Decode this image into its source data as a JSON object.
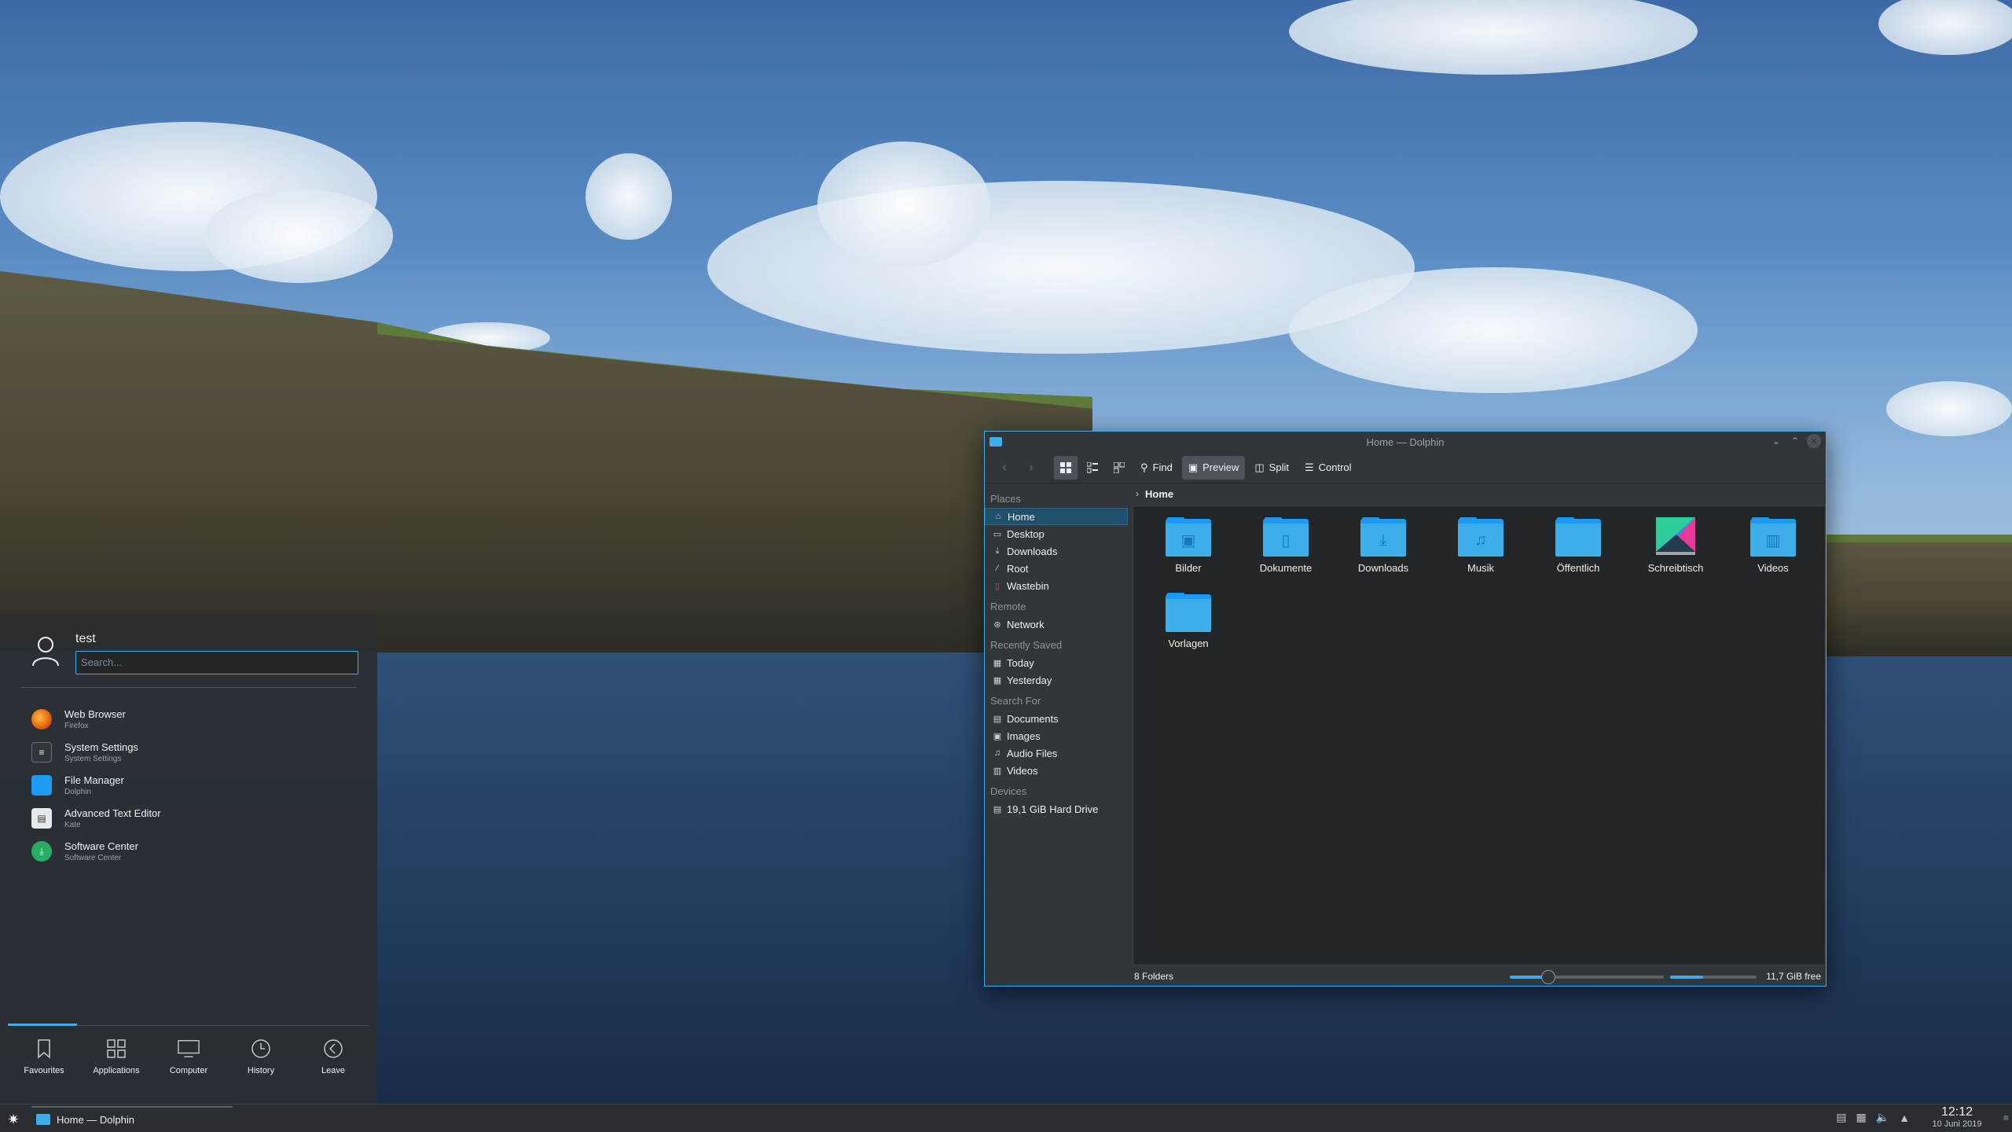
{
  "window": {
    "title": "Home — Dolphin"
  },
  "toolbar": {
    "find_label": "Find",
    "preview_label": "Preview",
    "split_label": "Split",
    "control_label": "Control"
  },
  "places": {
    "sections": [
      {
        "header": "Places",
        "items": [
          {
            "label": "Home",
            "icon": "home-icon",
            "selected": true
          },
          {
            "label": "Desktop",
            "icon": "desktop-icon"
          },
          {
            "label": "Downloads",
            "icon": "download-icon"
          },
          {
            "label": "Root",
            "icon": "root-icon"
          },
          {
            "label": "Wastebin",
            "icon": "trash-icon"
          }
        ]
      },
      {
        "header": "Remote",
        "items": [
          {
            "label": "Network",
            "icon": "network-icon"
          }
        ]
      },
      {
        "header": "Recently Saved",
        "items": [
          {
            "label": "Today",
            "icon": "calendar-icon"
          },
          {
            "label": "Yesterday",
            "icon": "calendar-icon"
          }
        ]
      },
      {
        "header": "Search For",
        "items": [
          {
            "label": "Documents",
            "icon": "document-icon"
          },
          {
            "label": "Images",
            "icon": "image-icon"
          },
          {
            "label": "Audio Files",
            "icon": "music-icon"
          },
          {
            "label": "Videos",
            "icon": "video-icon"
          }
        ]
      },
      {
        "header": "Devices",
        "items": [
          {
            "label": "19,1 GiB Hard Drive",
            "icon": "harddrive-icon"
          }
        ]
      }
    ]
  },
  "breadcrumb": {
    "current": "Home"
  },
  "files": [
    {
      "label": "Bilder",
      "icon": "image-icon"
    },
    {
      "label": "Dokumente",
      "icon": "document-icon"
    },
    {
      "label": "Downloads",
      "icon": "download-icon"
    },
    {
      "label": "Musik",
      "icon": "music-icon"
    },
    {
      "label": "Öffentlich",
      "icon": "public-icon"
    },
    {
      "label": "Schreibtisch",
      "icon": "desktop-folder-icon"
    },
    {
      "label": "Videos",
      "icon": "video-icon"
    },
    {
      "label": "Vorlagen",
      "icon": "template-icon"
    }
  ],
  "statusbar": {
    "folder_count": "8 Folders",
    "free_space": "11,7 GiB free",
    "zoom_level": 0.25,
    "disk_used_fraction": 0.38
  },
  "launcher": {
    "user_name": "test",
    "search_placeholder": "Search...",
    "favourites": [
      {
        "name": "Web Browser",
        "desc": "Firefox",
        "icon": "firefox-icon"
      },
      {
        "name": "System Settings",
        "desc": "System Settings",
        "icon": "settings-icon"
      },
      {
        "name": "File Manager",
        "desc": "Dolphin",
        "icon": "dolphin-icon"
      },
      {
        "name": "Advanced Text Editor",
        "desc": "Kate",
        "icon": "kate-icon"
      },
      {
        "name": "Software Center",
        "desc": "Software Center",
        "icon": "discover-icon"
      }
    ],
    "tabs": [
      {
        "label": "Favourites",
        "icon": "bookmark-icon"
      },
      {
        "label": "Applications",
        "icon": "apps-grid-icon"
      },
      {
        "label": "Computer",
        "icon": "monitor-icon"
      },
      {
        "label": "History",
        "icon": "clock-icon"
      },
      {
        "label": "Leave",
        "icon": "leave-icon"
      }
    ]
  },
  "taskbar": {
    "task_label": "Home — Dolphin",
    "clock_time": "12:12",
    "clock_date": "10 Juni 2019"
  },
  "colors": {
    "accent": "#3daee9",
    "folder": "#3daee9",
    "window_bg": "#232629",
    "panel_bg": "#31363b"
  }
}
